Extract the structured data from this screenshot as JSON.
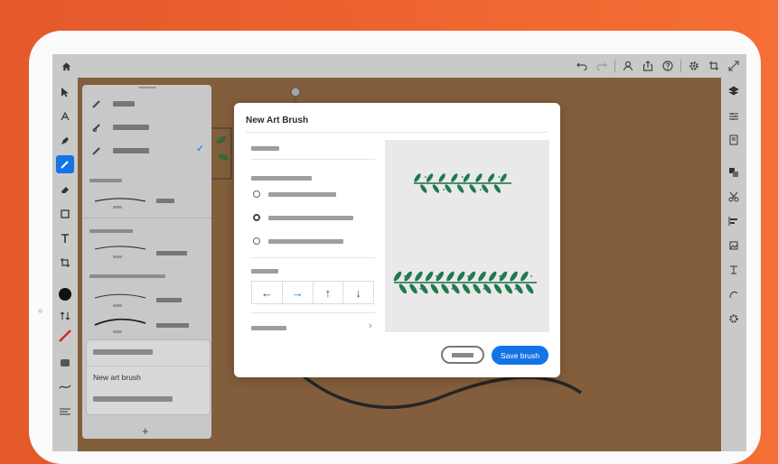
{
  "dialog": {
    "title": "New Art Brush",
    "save_label": "Save brush",
    "directions": [
      "←",
      "→",
      "↑",
      "↓"
    ],
    "selected_direction": "→",
    "chevron": "›"
  },
  "brush_panel": {
    "new_art_brush_label": "New art brush",
    "add_label": "+",
    "checkmark": "✓"
  },
  "toolbar_icons": [
    "home-icon",
    "undo-icon",
    "redo-icon",
    "user-icon",
    "share-icon",
    "help-icon",
    "settings-icon",
    "crop-icon",
    "expand-icon"
  ],
  "colors": {
    "accent": "#1473e6",
    "canvas": "#a96d36",
    "stroke": "#cc2b2b"
  }
}
